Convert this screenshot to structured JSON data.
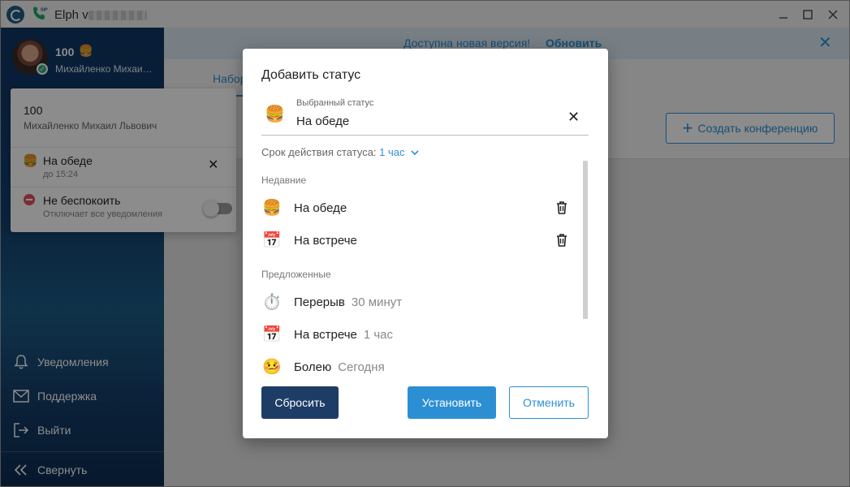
{
  "window": {
    "title": "Elph v.",
    "minimize_icon": "minimize-icon",
    "maximize_icon": "maximize-icon",
    "close_icon": "close-icon"
  },
  "sidebar": {
    "user": {
      "number": "100",
      "emoji": "🍔",
      "name": "Михайленко Михаил Львович",
      "status_color": "#2eb07b"
    },
    "items": [
      {
        "label": "Уведомления",
        "icon": "bell-icon"
      },
      {
        "label": "Поддержка",
        "icon": "mail-icon"
      },
      {
        "label": "Выйти",
        "icon": "logout-icon"
      }
    ],
    "collapse": {
      "label": "Свернуть",
      "icon": "double-chevron-left-icon"
    }
  },
  "profile_popup": {
    "number": "100",
    "full_name": "Михайленко Михаил Львович",
    "current_status": {
      "emoji": "🍔",
      "label": "На обеде",
      "until": "до 15:24"
    },
    "dnd": {
      "label": "Не беспокоить",
      "description": "Отключает все уведомления",
      "enabled": false,
      "color": "#e05260"
    }
  },
  "banner": {
    "text": "Доступна новая версия!",
    "link": "Обновить"
  },
  "main": {
    "tab": "Набор",
    "conference_button": "Создать конференцию"
  },
  "dialog": {
    "title": "Добавить статус",
    "selected": {
      "caption": "Выбранный статус",
      "emoji": "🍔",
      "value": "На обеде"
    },
    "duration": {
      "label": "Срок действия статуса:",
      "value": "1 час"
    },
    "recent_label": "Недавние",
    "recent": [
      {
        "emoji": "🍔",
        "label": "На обеде"
      },
      {
        "emoji": "📅",
        "label": "На встрече"
      }
    ],
    "suggested_label": "Предложенные",
    "suggested": [
      {
        "emoji": "⏱️",
        "label": "Перерыв",
        "duration": "30 минут"
      },
      {
        "emoji": "📅",
        "label": "На встрече",
        "duration": "1 час"
      },
      {
        "emoji": "🤒",
        "label": "Болею",
        "duration": "Сегодня"
      }
    ],
    "buttons": {
      "reset": "Сбросить",
      "set": "Установить",
      "cancel": "Отменить"
    },
    "colors": {
      "primary": "#2d8fd3",
      "dark": "#1e3d66"
    }
  }
}
